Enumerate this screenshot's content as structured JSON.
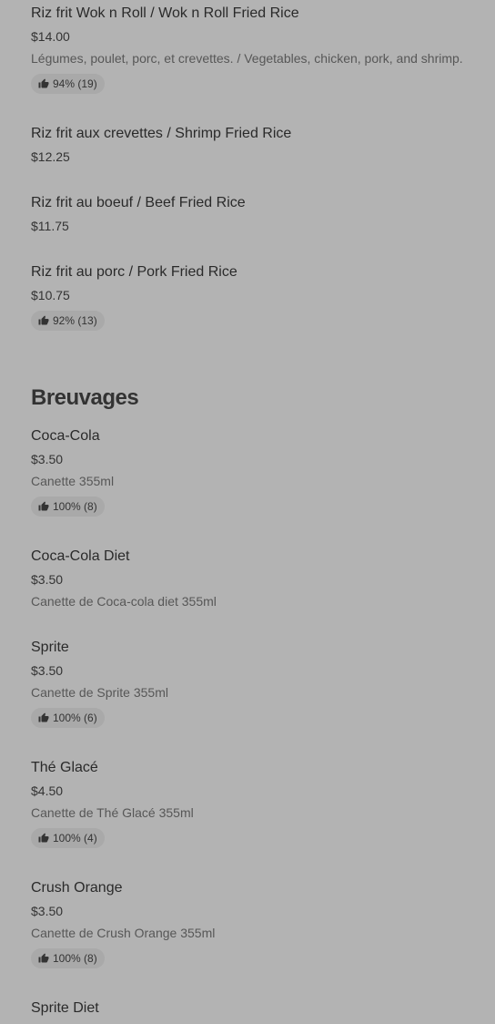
{
  "items_before": [
    {
      "name": "Riz frit Wok n Roll / Wok n Roll Fried Rice",
      "price": "$14.00",
      "desc": "Légumes, poulet, porc, et crevettes. / Vegetables, chicken, pork, and shrimp.",
      "rating": "94% (19)"
    },
    {
      "name": "Riz frit aux crevettes / Shrimp Fried Rice",
      "price": "$12.25"
    },
    {
      "name": "Riz frit au boeuf / Beef Fried Rice",
      "price": "$11.75"
    },
    {
      "name": "Riz frit au porc / Pork Fried Rice",
      "price": "$10.75",
      "rating": "92% (13)"
    }
  ],
  "section": {
    "title": "Breuvages"
  },
  "drinks": [
    {
      "name": "Coca-Cola",
      "price": "$3.50",
      "desc": "Canette 355ml",
      "rating": "100% (8)"
    },
    {
      "name": "Coca-Cola Diet",
      "price": "$3.50",
      "desc": "Canette de Coca-cola diet 355ml"
    },
    {
      "name": "Sprite",
      "price": "$3.50",
      "desc": "Canette de Sprite 355ml",
      "rating": "100% (6)"
    },
    {
      "name": "Thé Glacé",
      "price": "$4.50",
      "desc": "Canette de Thé Glacé 355ml",
      "rating": "100% (4)"
    },
    {
      "name": "Crush Orange",
      "price": "$3.50",
      "desc": "Canette de Crush Orange 355ml",
      "rating": "100% (8)"
    },
    {
      "name": "Sprite Diet"
    }
  ],
  "icons": {
    "rating": "thumbs-up-icon"
  }
}
